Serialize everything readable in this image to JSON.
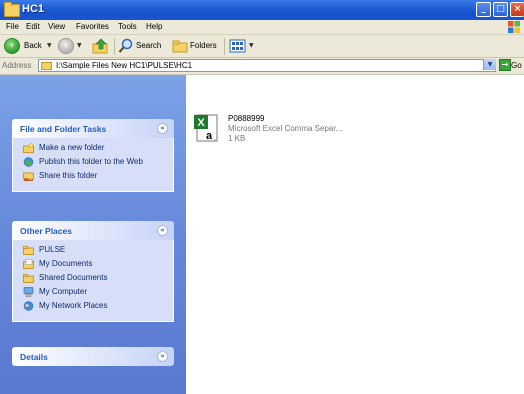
{
  "window": {
    "title": "HC1"
  },
  "menu": [
    "File",
    "Edit",
    "View",
    "Favorites",
    "Tools",
    "Help"
  ],
  "toolbar": {
    "back_label": "Back",
    "search_label": "Search",
    "folders_label": "Folders"
  },
  "address": {
    "label": "Address",
    "value": "I:\\Sample Files New HC1\\PULSE\\HC1",
    "go_label": "Go"
  },
  "tasks_panel": {
    "title": "File and Folder Tasks",
    "items": [
      {
        "label": "Make a new folder",
        "icon": "new-folder-icon"
      },
      {
        "label": "Publish this folder to the Web",
        "icon": "publish-web-icon"
      },
      {
        "label": "Share this folder",
        "icon": "share-folder-icon"
      }
    ]
  },
  "other_places": {
    "title": "Other Places",
    "items": [
      {
        "label": "PULSE",
        "icon": "folder-icon"
      },
      {
        "label": "My Documents",
        "icon": "my-documents-icon"
      },
      {
        "label": "Shared Documents",
        "icon": "shared-documents-icon"
      },
      {
        "label": "My Computer",
        "icon": "my-computer-icon"
      },
      {
        "label": "My Network Places",
        "icon": "network-places-icon"
      }
    ]
  },
  "details_panel": {
    "title": "Details"
  },
  "files": [
    {
      "name": "P0888999",
      "type": "Microsoft Excel Comma Separ...",
      "size": "1 KB",
      "icon": "excel-csv-icon"
    }
  ],
  "colors": {
    "titlebar": "#1f5fd8",
    "taskpane": "#6b8fdc",
    "panel_title": "#215dc6",
    "chrome": "#ece9d8"
  }
}
